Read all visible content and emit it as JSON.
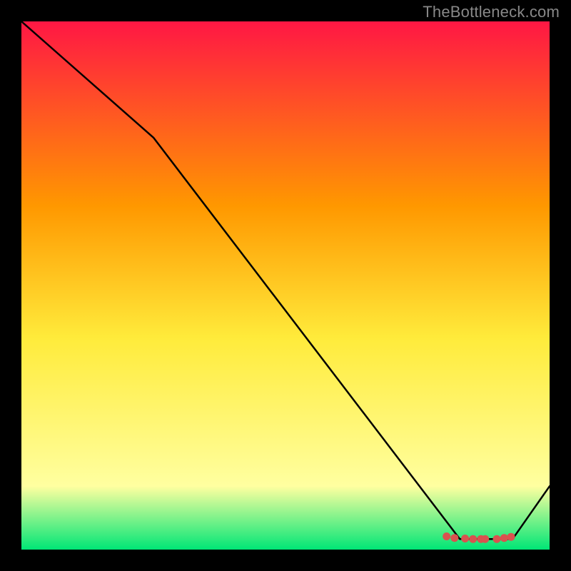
{
  "watermark": "TheBottleneck.com",
  "colors": {
    "background": "#000000",
    "line": "#000000",
    "marker": "#d9534f",
    "grad_top": "#ff1744",
    "grad_mid_upper": "#ff9800",
    "grad_mid": "#ffeb3b",
    "grad_lower": "#ffffa0",
    "grad_bottom": "#00e676"
  },
  "chart_data": {
    "type": "line",
    "x": [
      0.0,
      0.25,
      0.83,
      0.93,
      1.0
    ],
    "values": [
      1.0,
      0.78,
      0.02,
      0.02,
      0.12
    ],
    "xlim": [
      0,
      1
    ],
    "ylim": [
      0,
      1
    ],
    "title": "",
    "xlabel": "",
    "ylabel": "",
    "markers_x": [
      0.805,
      0.82,
      0.84,
      0.855,
      0.87,
      0.878,
      0.9,
      0.914,
      0.927
    ],
    "markers_y": [
      0.025,
      0.022,
      0.021,
      0.02,
      0.02,
      0.02,
      0.02,
      0.022,
      0.024
    ]
  }
}
